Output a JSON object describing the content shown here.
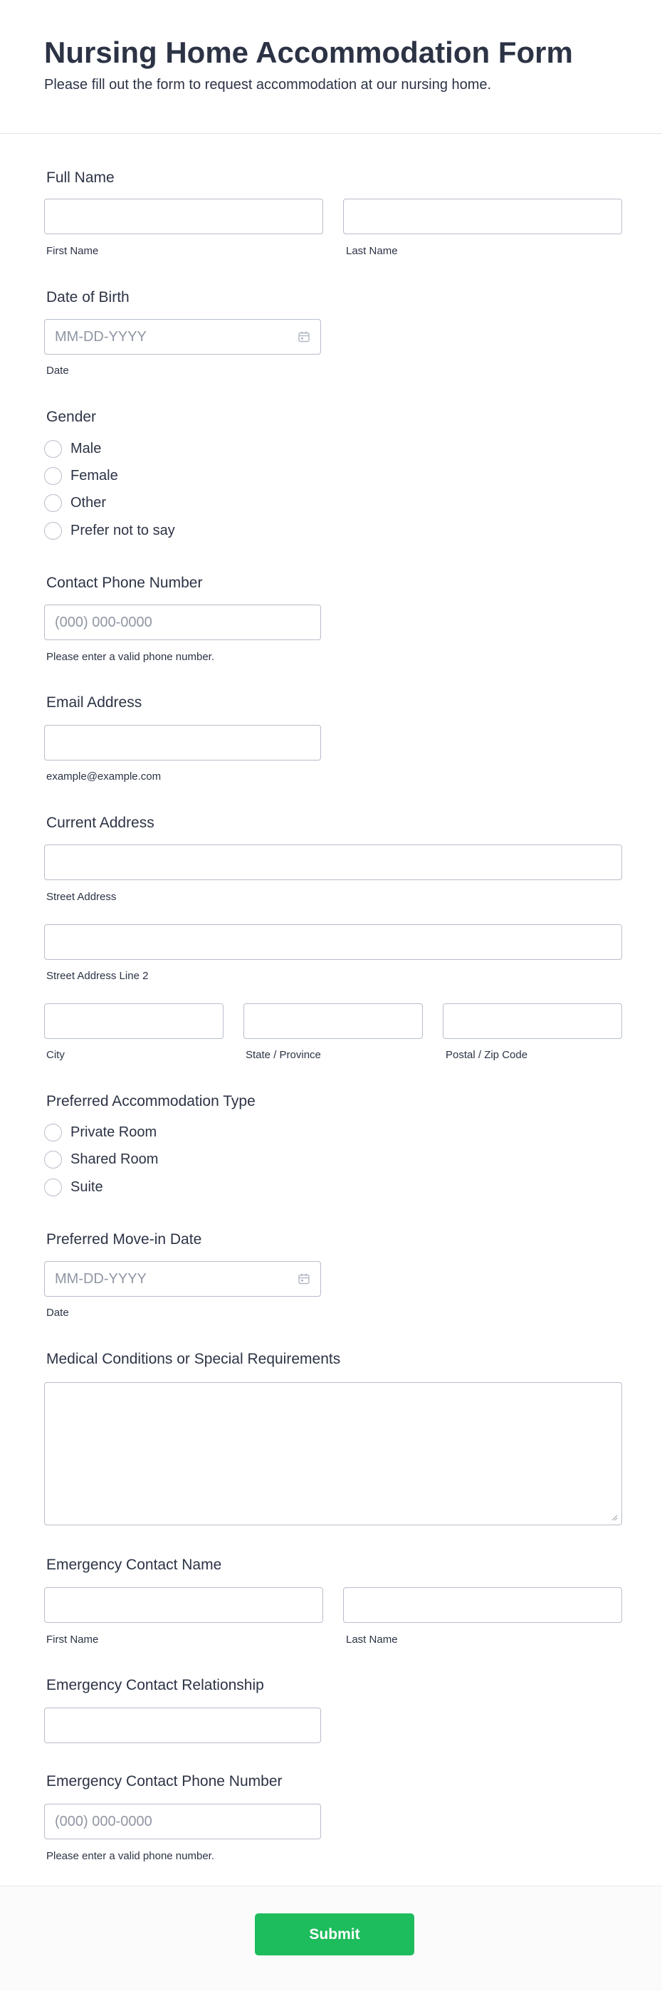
{
  "header": {
    "title": "Nursing Home Accommodation Form",
    "subtitle": "Please fill out the form to request accommodation at our nursing home."
  },
  "full_name": {
    "label": "Full Name",
    "first_sublabel": "First Name",
    "last_sublabel": "Last Name",
    "first_value": "",
    "last_value": ""
  },
  "dob": {
    "label": "Date of Birth",
    "placeholder": "MM-DD-YYYY",
    "sublabel": "Date",
    "icon": "calendar-icon"
  },
  "gender": {
    "label": "Gender",
    "options": [
      "Male",
      "Female",
      "Other",
      "Prefer not to say"
    ]
  },
  "phone": {
    "label": "Contact Phone Number",
    "placeholder": "(000) 000-0000",
    "sublabel": "Please enter a valid phone number."
  },
  "email": {
    "label": "Email Address",
    "value": "",
    "sublabel": "example@example.com"
  },
  "address": {
    "label": "Current Address",
    "street_sublabel": "Street Address",
    "street2_sublabel": "Street Address Line 2",
    "city_sublabel": "City",
    "state_sublabel": "State / Province",
    "zip_sublabel": "Postal / Zip Code"
  },
  "accommodation": {
    "label": "Preferred Accommodation Type",
    "options": [
      "Private Room",
      "Shared Room",
      "Suite"
    ]
  },
  "move_in": {
    "label": "Preferred Move-in Date",
    "placeholder": "MM-DD-YYYY",
    "sublabel": "Date",
    "icon": "calendar-icon"
  },
  "medical": {
    "label": "Medical Conditions or Special Requirements",
    "value": ""
  },
  "emergency_name": {
    "label": "Emergency Contact Name",
    "first_sublabel": "First Name",
    "last_sublabel": "Last Name"
  },
  "emergency_relationship": {
    "label": "Emergency Contact Relationship",
    "value": ""
  },
  "emergency_phone": {
    "label": "Emergency Contact Phone Number",
    "placeholder": "(000) 000-0000",
    "sublabel": "Please enter a valid phone number."
  },
  "footer": {
    "submit_label": "Submit"
  },
  "colors": {
    "text": "#2c3345",
    "border": "#b8bdc9",
    "placeholder": "#8f96a3",
    "submit": "#1dbc5c"
  }
}
